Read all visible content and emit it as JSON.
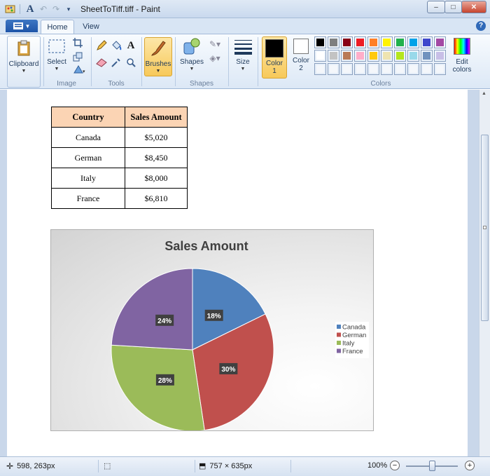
{
  "window": {
    "title": "SheetToTiff.tiff - Paint",
    "quick_access": [
      "paint-icon",
      "text-a-icon",
      "undo-icon",
      "redo-icon",
      "customize-icon"
    ],
    "controls": {
      "minimize": "–",
      "maximize": "□",
      "close": "✕"
    }
  },
  "ribbon": {
    "tabs": [
      {
        "label": "Home",
        "active": true
      },
      {
        "label": "View",
        "active": false
      }
    ],
    "groups": {
      "image": "Image",
      "tools": "Tools",
      "shapes": "Shapes",
      "colors": "Colors"
    },
    "buttons": {
      "clipboard": "Clipboard",
      "select": "Select",
      "brushes": "Brushes",
      "shapes": "Shapes",
      "size": "Size",
      "color1_a": "Color",
      "color1_b": "1",
      "color2_a": "Color",
      "color2_b": "2",
      "edit_colors_a": "Edit",
      "edit_colors_b": "colors"
    },
    "color1": "#000000",
    "color2": "#ffffff",
    "palette": [
      "#000000",
      "#7f7f7f",
      "#880015",
      "#ed1c24",
      "#ff7f27",
      "#fff200",
      "#22b14c",
      "#00a2e8",
      "#3f48cc",
      "#a349a4",
      "#ffffff",
      "#c3c3c3",
      "#b97a57",
      "#ffaec9",
      "#ffc90e",
      "#efe4b0",
      "#b5e61d",
      "#99d9ea",
      "#7092be",
      "#c8bfe7",
      "",
      "",
      "",
      "",
      "",
      "",
      "",
      "",
      "",
      ""
    ]
  },
  "document": {
    "table": {
      "headers": [
        "Country",
        "Sales Amount"
      ],
      "rows": [
        [
          "Canada",
          "$5,020"
        ],
        [
          "German",
          "$8,450"
        ],
        [
          "Italy",
          "$8,000"
        ],
        [
          "France",
          "$6,810"
        ]
      ]
    }
  },
  "chart_data": {
    "type": "pie",
    "title": "Sales Amount",
    "categories": [
      "Canada",
      "German",
      "Italy",
      "France"
    ],
    "values": [
      5020,
      8450,
      8000,
      6810
    ],
    "data_labels": [
      "18%",
      "30%",
      "28%",
      "24%"
    ],
    "colors": [
      "#4f81bd",
      "#c0504d",
      "#9bbb59",
      "#8064a2"
    ],
    "legend": "right"
  },
  "status": {
    "cursor": "598, 263px",
    "selection": "",
    "image_size": "757 × 635px",
    "zoom": "100%"
  }
}
